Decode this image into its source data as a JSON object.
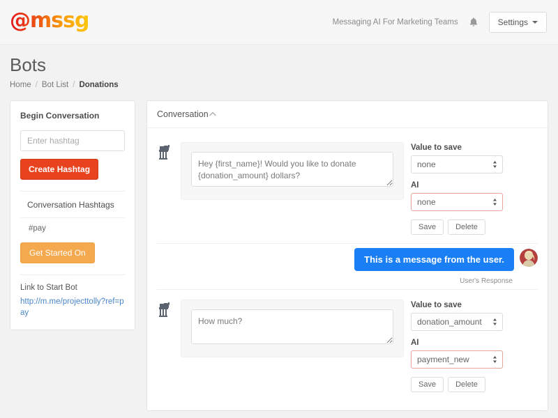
{
  "header": {
    "logo_text": "@mssg",
    "tagline": "Messaging AI For Marketing Teams",
    "bell_icon": "bell-icon",
    "settings_label": "Settings",
    "accent_red": "#e8431f",
    "accent_orange": "#f5a94e",
    "accent_blue": "#1a7ef5"
  },
  "page": {
    "title": "Bots",
    "breadcrumb": [
      {
        "label": "Home",
        "active": false
      },
      {
        "label": "Bot List",
        "active": false
      },
      {
        "label": "Donations",
        "active": true
      }
    ]
  },
  "sidebar": {
    "heading": "Begin Conversation",
    "hashtag_input_placeholder": "Enter hashtag",
    "hashtag_input_value": "",
    "create_button": "Create Hashtag",
    "hashtags_label": "Conversation Hashtags",
    "hashtags": [
      "#pay"
    ],
    "get_started_button": "Get Started On",
    "link_label": "Link to Start Bot",
    "bot_link": "http://m.me/projecttolly?ref=pay"
  },
  "conversation": {
    "panel_title": "Conversation",
    "collapse_icon": "chevron-up-icon",
    "bot_avatar_icon": "at-at-walker-icon",
    "user_avatar_icon": "user-photo-avatar",
    "user_caption": "User's Response",
    "blocks": [
      {
        "message": "Hey {first_name}! Would you like to donate {donation_amount} dollars?",
        "value_label": "Value to save",
        "value_selected": "none",
        "ai_label": "AI",
        "ai_selected": "none",
        "ai_invalid": true,
        "save_label": "Save",
        "delete_label": "Delete"
      },
      {
        "message": "How much?",
        "value_label": "Value to save",
        "value_selected": "donation_amount",
        "ai_label": "AI",
        "ai_selected": "payment_new",
        "ai_invalid": true,
        "save_label": "Save",
        "delete_label": "Delete"
      }
    ],
    "user_message": "This is a message from the user."
  }
}
